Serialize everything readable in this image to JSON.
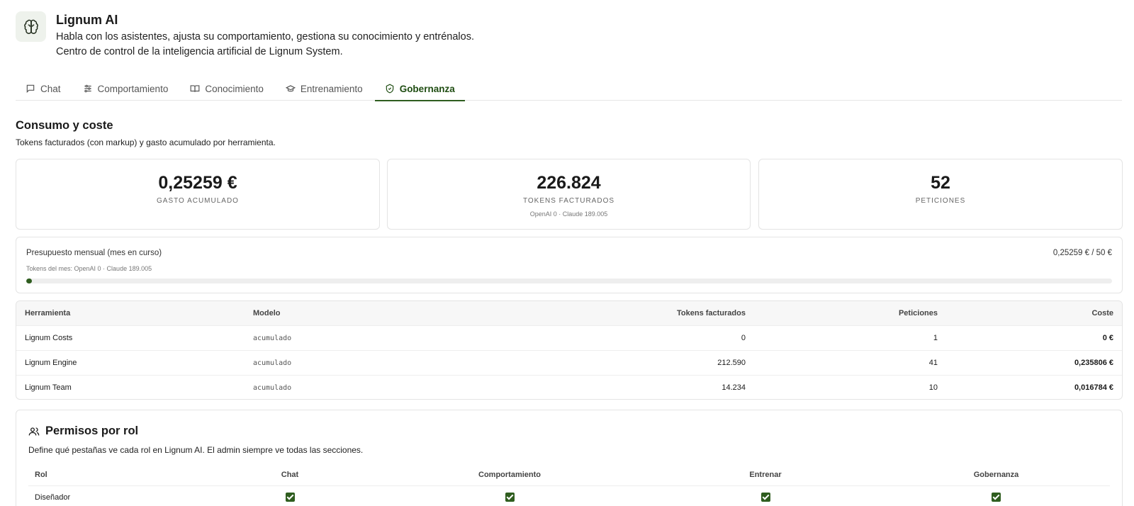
{
  "app": {
    "title": "Lignum AI",
    "subtitle_line1": "Habla con los asistentes, ajusta su comportamiento, gestiona su conocimiento y entrénalos.",
    "subtitle_line2": "Centro de control de la inteligencia artificial de Lignum System.",
    "logo_icon": "brain-icon"
  },
  "tabs": [
    {
      "label": "Chat",
      "icon": "chat-icon",
      "active": false
    },
    {
      "label": "Comportamiento",
      "icon": "sliders-icon",
      "active": false
    },
    {
      "label": "Conocimiento",
      "icon": "book-icon",
      "active": false
    },
    {
      "label": "Entrenamiento",
      "icon": "graduation-cap-icon",
      "active": false
    },
    {
      "label": "Gobernanza",
      "icon": "shield-check-icon",
      "active": true
    }
  ],
  "usage": {
    "title": "Consumo y coste",
    "subtitle": "Tokens facturados (con markup) y gasto acumulado por herramienta.",
    "stats": [
      {
        "value": "0,25259 €",
        "label": "GASTO ACUMULADO",
        "detail": ""
      },
      {
        "value": "226.824",
        "label": "TOKENS FACTURADOS",
        "detail": "OpenAI 0 · Claude 189.005"
      },
      {
        "value": "52",
        "label": "PETICIONES",
        "detail": ""
      }
    ]
  },
  "budget": {
    "label": "Presupuesto mensual (mes en curso)",
    "value": "0,25259 € / 50 €",
    "detail": "Tokens del mes: OpenAI 0 · Claude 189.005",
    "progress_fraction": 0.005
  },
  "tools_table": {
    "headers": [
      "Herramienta",
      "Modelo",
      "Tokens facturados",
      "Peticiones",
      "Coste"
    ],
    "rows": [
      [
        "Lignum Costs",
        "acumulado",
        "0",
        "1",
        "0 €"
      ],
      [
        "Lignum Engine",
        "acumulado",
        "212.590",
        "41",
        "0,235806 €"
      ],
      [
        "Lignum Team",
        "acumulado",
        "14.234",
        "10",
        "0,016784 €"
      ]
    ]
  },
  "permissions": {
    "title": "Permisos por rol",
    "icon": "users-icon",
    "subtitle": "Define qué pestañas ve cada rol en Lignum AI. El admin siempre ve todas las secciones.",
    "headers": [
      "Rol",
      "Chat",
      "Comportamiento",
      "Entrenar",
      "Gobernanza"
    ],
    "rows": [
      {
        "role": "Diseñador",
        "checks": [
          true,
          true,
          true,
          true
        ]
      }
    ]
  },
  "colors": {
    "accent": "#2f5d1f",
    "logo_bg": "#eef2ec",
    "border": "#e4e4e4"
  }
}
